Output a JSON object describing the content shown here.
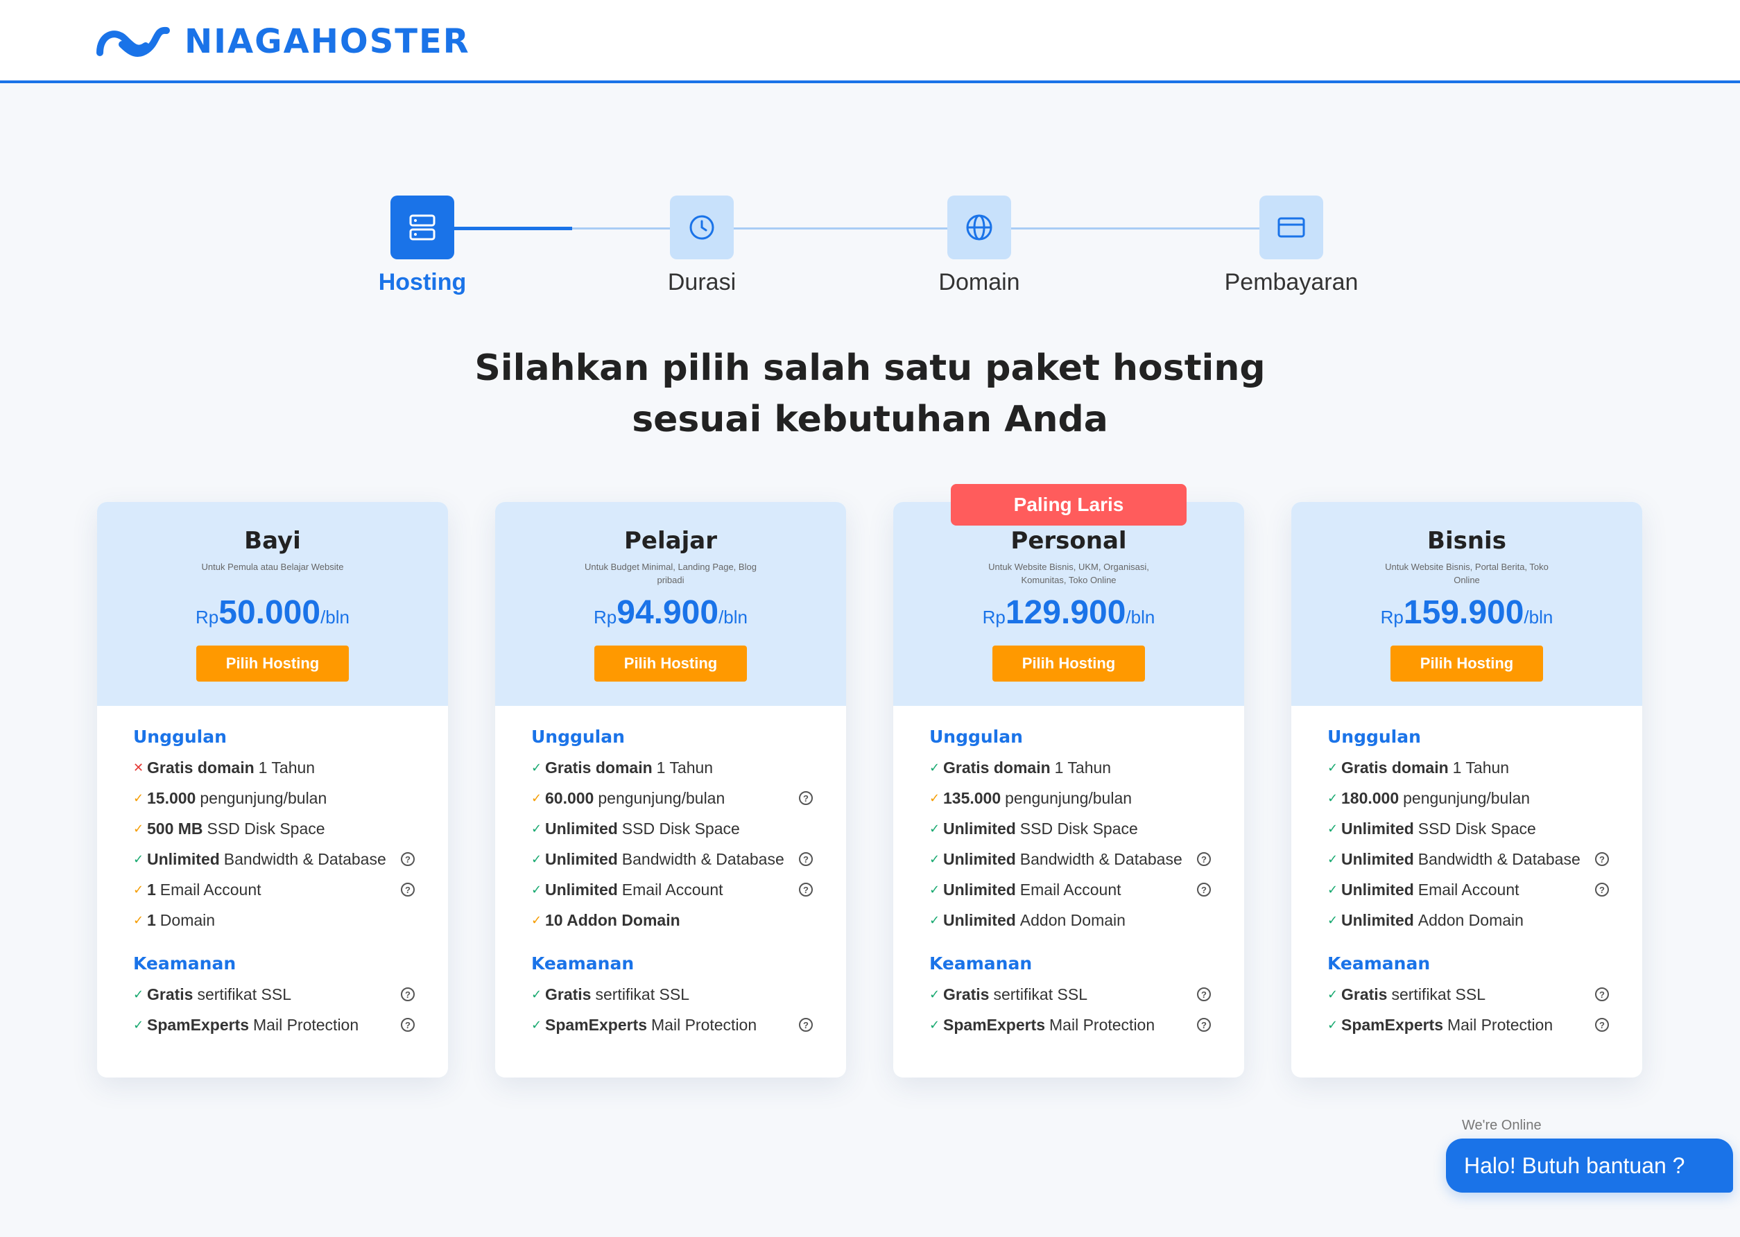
{
  "brand": {
    "name": "NIAGAHOSTER",
    "color": "#1a73e8"
  },
  "steps": [
    {
      "label": "Hosting",
      "icon": "server-icon",
      "active": true
    },
    {
      "label": "Durasi",
      "icon": "clock-icon",
      "active": false
    },
    {
      "label": "Domain",
      "icon": "globe-icon",
      "active": false
    },
    {
      "label": "Pembayaran",
      "icon": "credit-card-icon",
      "active": false
    }
  ],
  "headline": {
    "line1": "Silahkan pilih salah satu paket hosting",
    "line2": "sesuai kebutuhan Anda"
  },
  "plans": [
    {
      "name": "Bayi",
      "desc": "Untuk Pemula atau Belajar Website",
      "price": {
        "currency": "Rp",
        "amount": "50.000",
        "period": "/bln"
      },
      "button": "Pilih Hosting",
      "unggulan_title": "Unggulan",
      "features": [
        {
          "mark": "no",
          "bold": "Gratis domain",
          "text": "1 Tahun",
          "help": false
        },
        {
          "mark": "warn",
          "bold": "15.000",
          "text": "pengunjung/bulan",
          "help": false
        },
        {
          "mark": "warn",
          "bold": "500 MB",
          "text": "SSD Disk Space",
          "help": false
        },
        {
          "mark": "ok",
          "bold": "Unlimited",
          "text": "Bandwidth & Database",
          "help": true
        },
        {
          "mark": "warn",
          "bold": "1",
          "text": "Email Account",
          "help": true
        },
        {
          "mark": "warn",
          "bold": "1",
          "text": "Domain",
          "help": false
        }
      ],
      "keamanan_title": "Keamanan",
      "security": [
        {
          "mark": "ok",
          "bold": "Gratis",
          "text": "sertifikat SSL",
          "help": true
        },
        {
          "mark": "ok",
          "bold": "SpamExperts",
          "text": "Mail Protection",
          "help": true
        }
      ]
    },
    {
      "name": "Pelajar",
      "desc": "Untuk Budget Minimal, Landing Page, Blog pribadi",
      "price": {
        "currency": "Rp",
        "amount": "94.900",
        "period": "/bln"
      },
      "button": "Pilih Hosting",
      "unggulan_title": "Unggulan",
      "features": [
        {
          "mark": "ok",
          "bold": "Gratis domain",
          "text": "1 Tahun",
          "help": false
        },
        {
          "mark": "warn",
          "bold": "60.000",
          "text": "pengunjung/bulan",
          "help": true
        },
        {
          "mark": "ok",
          "bold": "Unlimited",
          "text": "SSD Disk Space",
          "help": false
        },
        {
          "mark": "ok",
          "bold": "Unlimited",
          "text": "Bandwidth & Database",
          "help": true
        },
        {
          "mark": "ok",
          "bold": "Unlimited",
          "text": "Email Account",
          "help": true
        },
        {
          "mark": "warn",
          "bold": "10 Addon Domain",
          "text": "",
          "help": false
        }
      ],
      "keamanan_title": "Keamanan",
      "security": [
        {
          "mark": "ok",
          "bold": "Gratis",
          "text": "sertifikat SSL",
          "help": false
        },
        {
          "mark": "ok",
          "bold": "SpamExperts",
          "text": "Mail Protection",
          "help": true
        }
      ]
    },
    {
      "name": "Personal",
      "badge": "Paling Laris",
      "desc": "Untuk Website Bisnis, UKM, Organisasi, Komunitas, Toko Online",
      "price": {
        "currency": "Rp",
        "amount": "129.900",
        "period": "/bln"
      },
      "button": "Pilih Hosting",
      "unggulan_title": "Unggulan",
      "features": [
        {
          "mark": "ok",
          "bold": "Gratis domain",
          "text": "1 Tahun",
          "help": false
        },
        {
          "mark": "warn",
          "bold": "135.000",
          "text": "pengunjung/bulan",
          "help": false
        },
        {
          "mark": "ok",
          "bold": "Unlimited",
          "text": "SSD Disk Space",
          "help": false
        },
        {
          "mark": "ok",
          "bold": "Unlimited",
          "text": "Bandwidth & Database",
          "help": true
        },
        {
          "mark": "ok",
          "bold": "Unlimited",
          "text": "Email Account",
          "help": true
        },
        {
          "mark": "ok",
          "bold": "Unlimited",
          "text": "Addon Domain",
          "help": false
        }
      ],
      "keamanan_title": "Keamanan",
      "security": [
        {
          "mark": "ok",
          "bold": "Gratis",
          "text": "sertifikat SSL",
          "help": true
        },
        {
          "mark": "ok",
          "bold": "SpamExperts",
          "text": "Mail Protection",
          "help": true
        }
      ]
    },
    {
      "name": "Bisnis",
      "desc": "Untuk Website Bisnis, Portal Berita, Toko Online",
      "price": {
        "currency": "Rp",
        "amount": "159.900",
        "period": "/bln"
      },
      "button": "Pilih Hosting",
      "unggulan_title": "Unggulan",
      "features": [
        {
          "mark": "ok",
          "bold": "Gratis domain",
          "text": "1 Tahun",
          "help": false
        },
        {
          "mark": "ok",
          "bold": "180.000",
          "text": "pengunjung/bulan",
          "help": false
        },
        {
          "mark": "ok",
          "bold": "Unlimited",
          "text": "SSD Disk Space",
          "help": false
        },
        {
          "mark": "ok",
          "bold": "Unlimited",
          "text": "Bandwidth & Database",
          "help": true
        },
        {
          "mark": "ok",
          "bold": "Unlimited",
          "text": "Email Account",
          "help": true
        },
        {
          "mark": "ok",
          "bold": "Unlimited",
          "text": "Addon Domain",
          "help": false
        }
      ],
      "keamanan_title": "Keamanan",
      "security": [
        {
          "mark": "ok",
          "bold": "Gratis",
          "text": "sertifikat SSL",
          "help": true
        },
        {
          "mark": "ok",
          "bold": "SpamExperts",
          "text": "Mail Protection",
          "help": true
        }
      ]
    }
  ],
  "chat": {
    "status": "We're Online",
    "label": "Halo! Butuh bantuan ?"
  },
  "colors": {
    "accent": "#1a73e8",
    "cta": "#ff9900",
    "badge": "#ff5c5c",
    "ok": "#15a86e",
    "warn": "#f59c00",
    "no": "#e53935"
  }
}
